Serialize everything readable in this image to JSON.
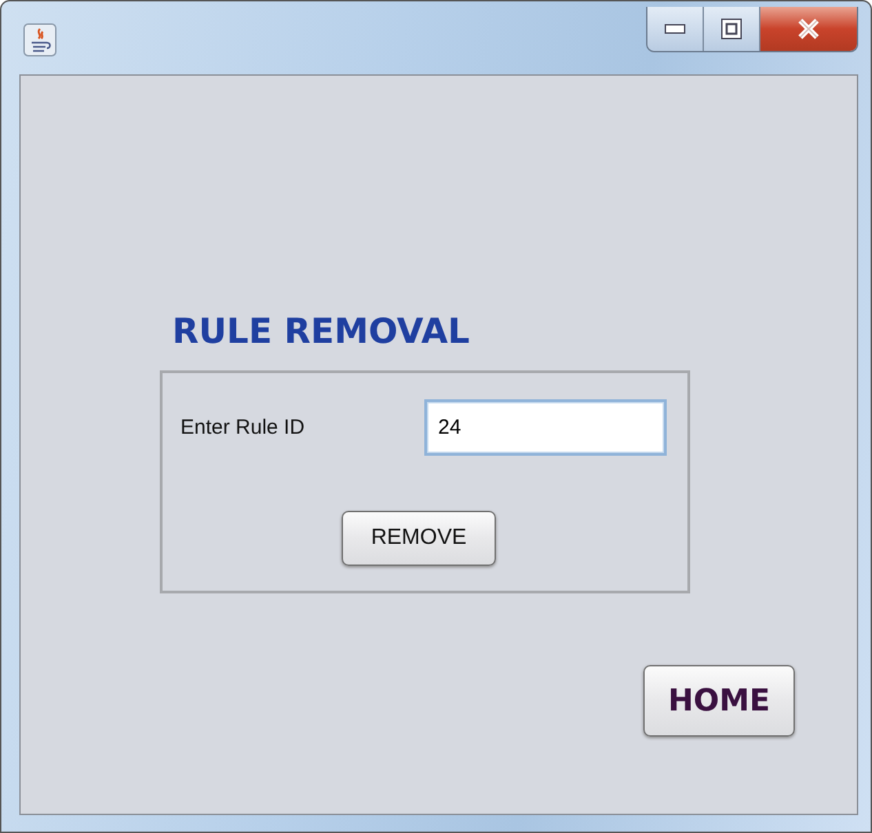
{
  "heading": "RULE REMOVAL",
  "form": {
    "label": "Enter Rule ID",
    "value": "24",
    "button": "REMOVE"
  },
  "home_button": "HOME"
}
